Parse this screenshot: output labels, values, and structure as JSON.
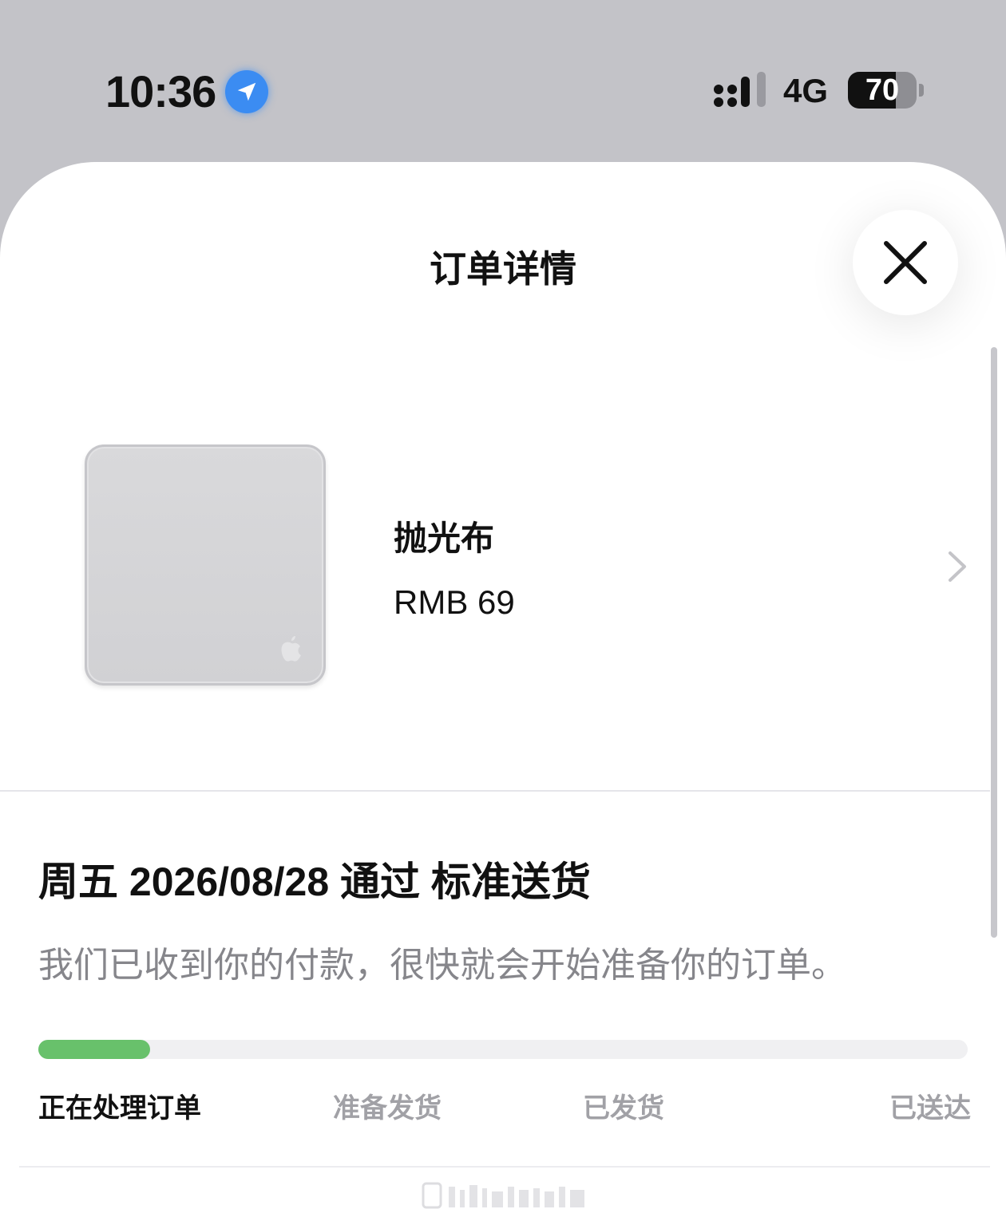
{
  "status_bar": {
    "time": "10:36",
    "network": "4G",
    "battery_level": "70",
    "battery_fraction": 0.7
  },
  "sheet": {
    "title": "订单详情"
  },
  "product": {
    "name": "抛光布",
    "price": "RMB 69"
  },
  "delivery": {
    "title": "周五 2026/08/28 通过 标准送货",
    "message": "我们已收到你的付款，很快就会开始准备你的订单。",
    "progress_fraction": 0.12,
    "steps": [
      "正在处理订单",
      "准备发货",
      "已发货",
      "已送达"
    ],
    "active_step": 0
  },
  "colors": {
    "progress_green": "#68c16b",
    "location_blue": "#3b8cf2",
    "secondary_text": "#86868b"
  }
}
